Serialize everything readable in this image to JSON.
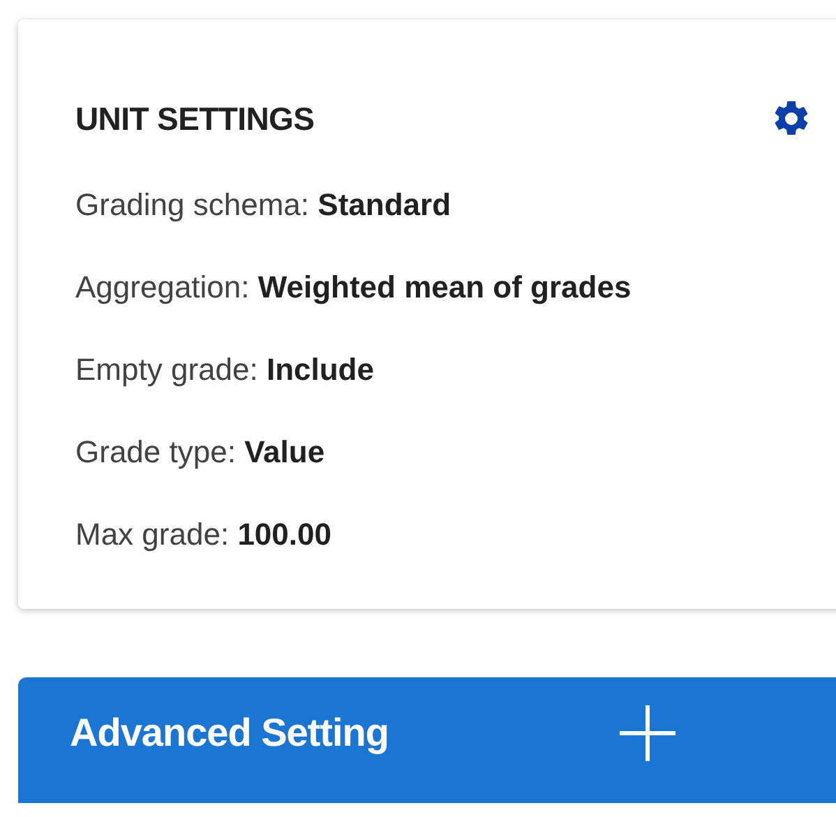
{
  "card": {
    "title": "UNIT SETTINGS",
    "settings": [
      {
        "label": "Grading schema:",
        "value": "Standard"
      },
      {
        "label": "Aggregation:",
        "value": "Weighted mean of grades"
      },
      {
        "label": "Empty grade:",
        "value": "Include"
      },
      {
        "label": "Grade type:",
        "value": "Value"
      },
      {
        "label": "Max grade:",
        "value": "100.00"
      }
    ]
  },
  "advanced_button": {
    "label": "Advanced Setting"
  }
}
